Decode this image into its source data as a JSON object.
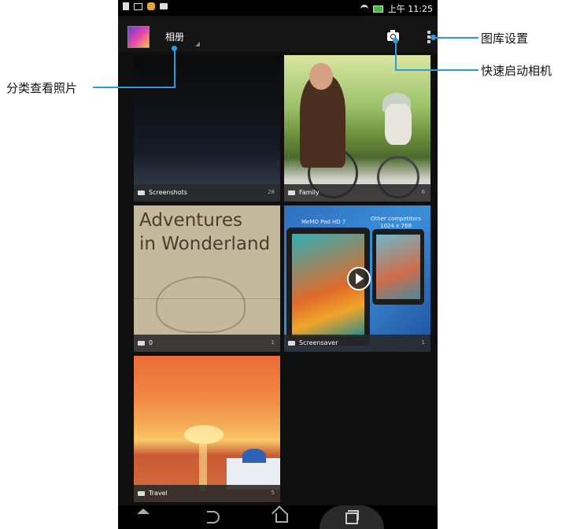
{
  "status_bar": {
    "time": "上午 11:25"
  },
  "action_bar": {
    "album_label": "相册"
  },
  "albums": [
    {
      "name": "Screenshots",
      "count": "28"
    },
    {
      "name": "Family",
      "count": "6"
    },
    {
      "name": "0",
      "count": "1"
    },
    {
      "name": "Screensaver",
      "count": "1"
    },
    {
      "name": "Travel",
      "count": "5"
    }
  ],
  "tile_texts": {
    "alice_line1": "Adventures",
    "alice_line2": "in Wonderland",
    "saver_product": "MeMO Pad HD 7",
    "saver_other_1": "Other competitors",
    "saver_other_2": "1024 x 768"
  },
  "callouts": {
    "settings": "图库设置",
    "camera": "快速启动相机",
    "sort": "分类查看照片"
  },
  "colors": {
    "callout_line": "#2f9ad8",
    "background": "#0f0f0f"
  }
}
